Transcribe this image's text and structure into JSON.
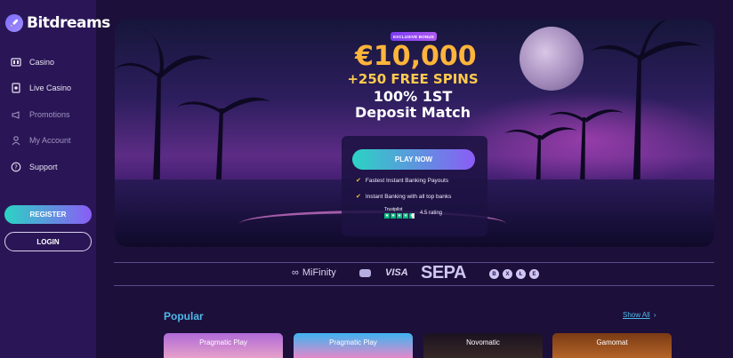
{
  "sidebar": {
    "logo_text": "Bitdreams",
    "items": [
      {
        "label": "Casino",
        "icon": "casino-icon"
      },
      {
        "label": "Live Casino",
        "icon": "live-casino-icon"
      },
      {
        "label": "Promotions",
        "icon": "megaphone-icon"
      },
      {
        "label": "My Account",
        "icon": "user-icon"
      },
      {
        "label": "Support",
        "icon": "help-icon"
      }
    ],
    "register_label": "REGISTER",
    "login_label": "LOGIN"
  },
  "hero": {
    "badge": "EXCLUSIVE BONUS",
    "amount": "€10,000",
    "spins": "+250 FREE SPINS",
    "match_line1": "100% 1ST",
    "match_line2": "Deposit Match",
    "play_label": "PLAY NOW",
    "features": [
      "Fastest Instant Banking Payouts",
      "Instant Banking with all top banks"
    ],
    "trustpilot_name": "Trustpilot",
    "rating_text": "4.5 rating",
    "rating_value": 4.5
  },
  "payments": {
    "mifinity": "MiFinity",
    "visa": "VISA",
    "sepa": "SEPA",
    "crypto": [
      "B",
      "X",
      "Ł",
      "E"
    ]
  },
  "popular": {
    "title": "Popular",
    "show_all": "Show All",
    "games": [
      {
        "label": "Pragmatic Play"
      },
      {
        "label": "Pragmatic Play"
      },
      {
        "label": "Novomatic"
      },
      {
        "label": "Gamomat"
      }
    ]
  },
  "colors": {
    "accent_gradient_start": "#2bd3c4",
    "accent_gradient_end": "#8b5cf6",
    "bonus_gold": "#ffb43a",
    "link_blue": "#4fb8e8",
    "sidebar_bg": "#2a1656",
    "page_bg": "#1c0f3a"
  }
}
